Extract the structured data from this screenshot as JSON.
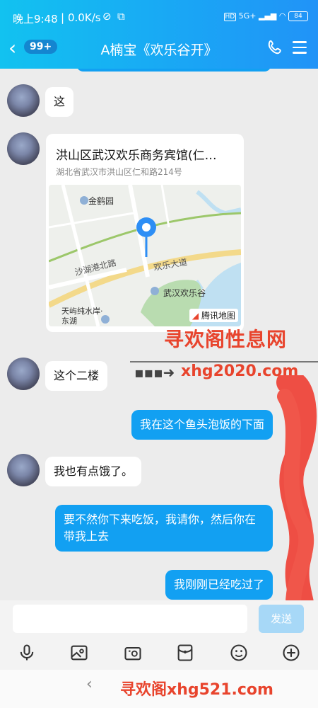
{
  "status_bar": {
    "time": "晚上9:48",
    "net_speed": "0.0K/s",
    "signal": "5G+",
    "battery": "84"
  },
  "header": {
    "unread_count": "99+",
    "title": "A楠宝《欢乐谷开》"
  },
  "messages": [
    {
      "side": "in",
      "text": "这"
    },
    {
      "side": "in",
      "type": "location",
      "place_name": "洪山区武汉欢乐商务宾馆(仁…",
      "address": "湖北省武汉市洪山区仁和路214号",
      "map": {
        "labels": [
          "金鹤园",
          "沙湖港北路",
          "欢乐大道",
          "武汉欢乐谷",
          "天屿纯水岸·东湖"
        ],
        "provider": "腾讯地图"
      }
    },
    {
      "side": "in",
      "text": "这个二楼"
    },
    {
      "side": "out",
      "text": "我在这个鱼头泡饭的下面"
    },
    {
      "side": "in",
      "text": "我也有点饿了。"
    },
    {
      "side": "out",
      "text": "要不然你下来吃饭，我请你，然后你在带我上去"
    },
    {
      "side": "out",
      "text": "我刚刚已经吃过了"
    }
  ],
  "input": {
    "placeholder": "",
    "send_label": "发送"
  },
  "toolbar_icons": [
    "microphone-icon",
    "image-icon",
    "camera-icon",
    "red-packet-icon",
    "emoji-icon",
    "plus-icon"
  ],
  "watermarks": {
    "top": "寻欢阁性息网",
    "middle": "xhg2020.com",
    "bottom": "寻欢阁xhg521.com"
  },
  "colors": {
    "header_start": "#12c2f0",
    "header_end": "#2193f7",
    "out_bubble": "#12a0f2",
    "in_bubble": "#ffffff",
    "watermark": "#e8442d"
  }
}
